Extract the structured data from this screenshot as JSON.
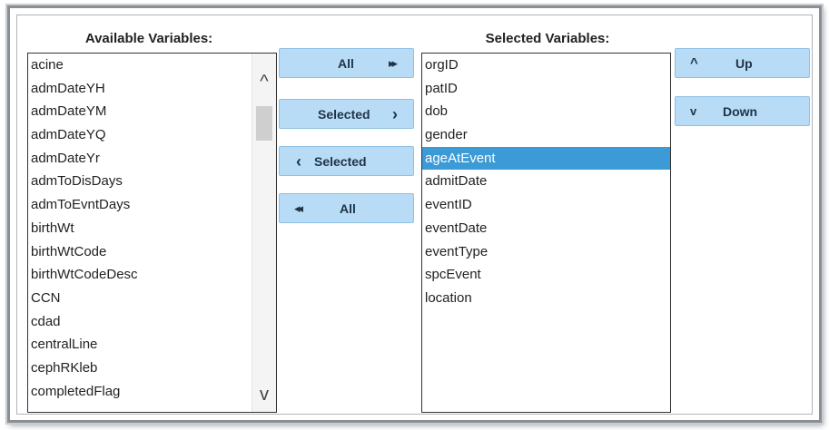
{
  "available": {
    "heading": "Available Variables:",
    "items": [
      "acine",
      "admDateYH",
      "admDateYM",
      "admDateYQ",
      "admDateYr",
      "admToDisDays",
      "admToEvntDays",
      "birthWt",
      "birthWtCode",
      "birthWtCodeDesc",
      "CCN",
      "cdad",
      "centralLine",
      "cephRKleb",
      "completedFlag"
    ]
  },
  "selected": {
    "heading": "Selected Variables:",
    "items": [
      "orgID",
      "patID",
      "dob",
      "gender",
      "ageAtEvent",
      "admitDate",
      "eventID",
      "eventDate",
      "eventType",
      "spcEvent",
      "location"
    ],
    "highlighted_item": "ageAtEvent"
  },
  "buttons": {
    "move_all_right": {
      "label": "All",
      "icon": "double-chevron-right-icon",
      "glyph": "▸▸"
    },
    "move_selected_right": {
      "label": "Selected",
      "icon": "chevron-right-icon",
      "glyph": "›"
    },
    "move_selected_left": {
      "label": "Selected",
      "icon": "chevron-left-icon",
      "glyph": "‹"
    },
    "move_all_left": {
      "label": "All",
      "icon": "double-chevron-left-icon",
      "glyph": "◂◂"
    },
    "up": {
      "label": "Up",
      "icon": "chevron-up-icon",
      "glyph": "^"
    },
    "down": {
      "label": "Down",
      "icon": "chevron-down-icon",
      "glyph": "v"
    }
  },
  "scrollbar": {
    "up_glyph": "^",
    "down_glyph": "v"
  },
  "colors": {
    "button_bg": "#b8dcf5",
    "highlight": "#3c9bd6"
  }
}
